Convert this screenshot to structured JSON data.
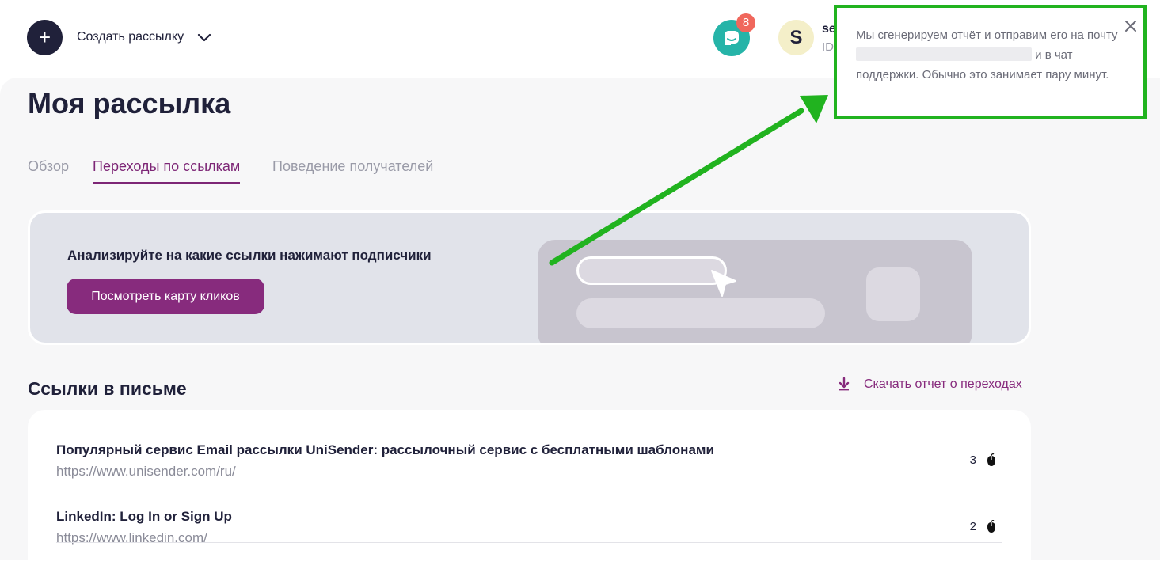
{
  "header": {
    "create_button_icon": "plus-icon",
    "create_label": "Создать рассылку",
    "chat_badge_count": "8",
    "avatar_letter": "S",
    "user_name": "se",
    "user_id": "ID"
  },
  "page": {
    "title": "Моя рассылка",
    "tabs": [
      {
        "label": "Обзор",
        "active": false
      },
      {
        "label": "Переходы по ссылкам",
        "active": true
      },
      {
        "label": "Поведение получателей",
        "active": false
      }
    ]
  },
  "banner": {
    "title": "Анализируйте на какие ссылки нажимают подписчики",
    "button_label": "Посмотреть карту кликов"
  },
  "links_section": {
    "title": "Ссылки в письме",
    "download_label": "Скачать отчет о переходах",
    "items": [
      {
        "title": "Популярный сервис Email рассылки UniSender: рассылочный сервис с бесплатными шаблонами",
        "url": "https://www.unisender.com/ru/",
        "clicks": "3"
      },
      {
        "title": "LinkedIn: Log In or Sign Up",
        "url": "https://www.linkedin.com/",
        "clicks": "2"
      }
    ]
  },
  "toast": {
    "text_before_email": "Мы сгенерируем отчёт и отправим его на почту ",
    "text_after_email": " и в чат поддержки. Обычно это занимает пару минут."
  },
  "colors": {
    "accent": "#872b7d",
    "tab_active": "#7d2676",
    "chat": "#26b4a8",
    "badge": "#f0675c",
    "annotation": "#21b31f"
  }
}
